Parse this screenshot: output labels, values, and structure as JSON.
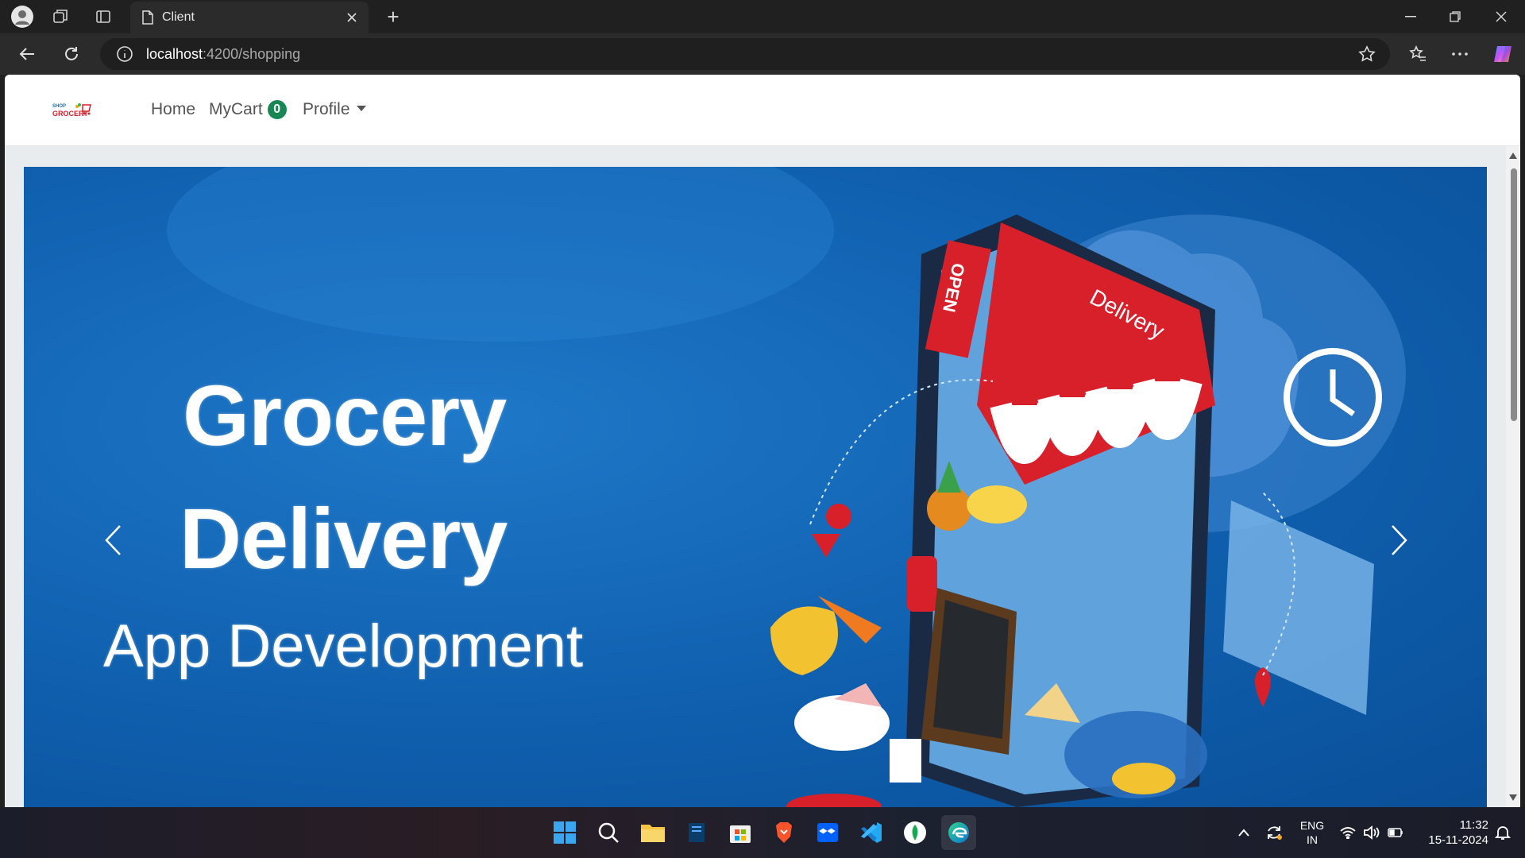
{
  "browser": {
    "tab_title": "Client",
    "url_host": "localhost",
    "url_rest": ":4200/shopping"
  },
  "app": {
    "logo_text_top": "SHOP",
    "logo_text": "GROCERY",
    "nav": {
      "home": "Home",
      "mycart": "MyCart",
      "cart_count": "0",
      "profile": "Profile"
    }
  },
  "carousel": {
    "line1": "Grocery",
    "line2": "Delivery",
    "line3": "App Development",
    "sign_open": "OPEN",
    "sign_delivery": "Delivery"
  },
  "taskbar": {
    "lang_top": "ENG",
    "lang_bottom": "IN",
    "time": "11:32",
    "date": "15-11-2024"
  },
  "colors": {
    "badge": "#198754",
    "carousel_bg": "#0f5fae",
    "awning_red": "#d8202b"
  }
}
